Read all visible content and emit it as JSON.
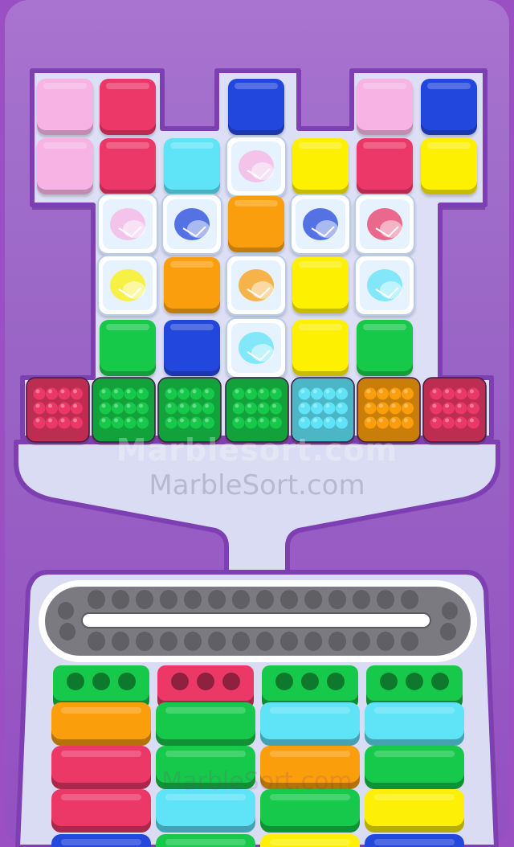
{
  "watermark": {
    "primary": "Marblesort.com",
    "secondary": "MarbleSort.com",
    "bottom": "MarbleSort.com"
  },
  "colors": {
    "pink": "#f7b3e4",
    "red": "#ec3867",
    "blue": "#2447dc",
    "cyan": "#5fe3f7",
    "yellow": "#fdf006",
    "orange": "#fb9e0c",
    "green": "#17c94a",
    "frozen": "#e6f2fd"
  },
  "board": {
    "columns": 7,
    "rows": [
      [
        "pink",
        "red",
        null,
        "blue",
        null,
        "pink",
        "blue"
      ],
      [
        "pink",
        "red",
        "cyan",
        "frozen:pink",
        "yellow",
        "red",
        "yellow"
      ],
      [
        null,
        "frozen:pink",
        "frozen:blue",
        "orange",
        "frozen:blue",
        "frozen:red",
        null
      ],
      [
        null,
        "frozen:yellow",
        "orange",
        "frozen:orange",
        "yellow",
        "frozen:cyan",
        null
      ],
      [
        null,
        "green",
        "blue",
        "frozen:cyan",
        "yellow",
        "green",
        null
      ]
    ]
  },
  "collectors": [
    "red",
    "green",
    "green",
    "green",
    "cyan",
    "orange",
    "red"
  ],
  "conveyor": {
    "slots_per_row": 14,
    "filled": 0
  },
  "queues": [
    [
      "green",
      "orange",
      "red",
      "red",
      "blue"
    ],
    [
      "red",
      "green",
      "green",
      "cyan",
      "green"
    ],
    [
      "green",
      "cyan",
      "orange",
      "green",
      "yellow"
    ],
    [
      "green",
      "cyan",
      "green",
      "yellow",
      "blue"
    ]
  ]
}
